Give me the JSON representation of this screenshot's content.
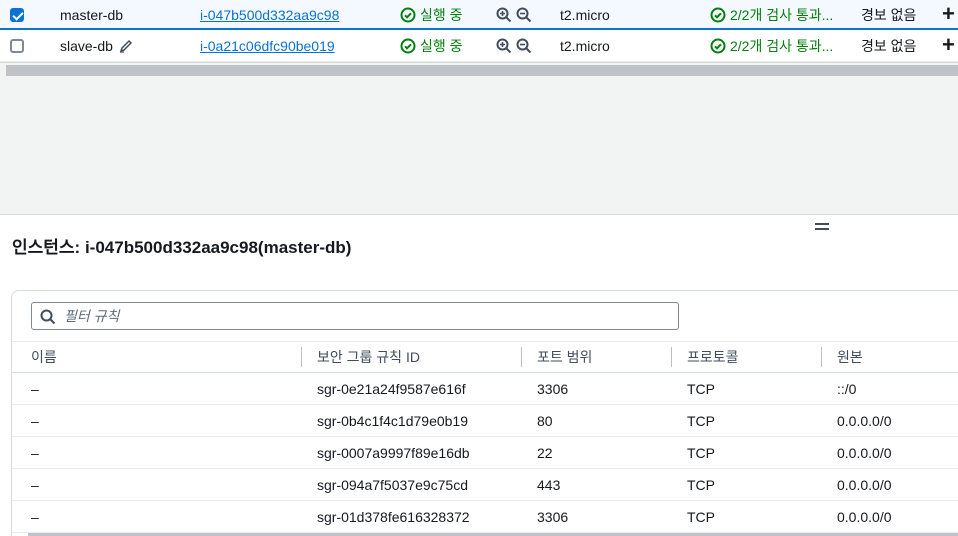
{
  "instances": [
    {
      "checked": true,
      "name": "master-db",
      "instance_id": "i-047b500d332aa9c98",
      "state": "실행 중",
      "type": "t2.micro",
      "status_check": "2/2개 검사 통과...",
      "alarm": "경보 없음",
      "add": "+"
    },
    {
      "checked": false,
      "name": "slave-db",
      "instance_id": "i-0a21c06dfc90be019",
      "state": "실행 중",
      "type": "t2.micro",
      "status_check": "2/2개 검사 통과...",
      "alarm": "경보 없음",
      "add": "+"
    }
  ],
  "panel": {
    "title": "인스턴스: i-047b500d332aa9c98(master-db)"
  },
  "rules": {
    "filter_placeholder": "필터 규칙",
    "columns": [
      "이름",
      "보안 그룹 규칙 ID",
      "포트 범위",
      "프로토콜",
      "원본"
    ],
    "rows": [
      [
        "–",
        "sgr-0e21a24f9587e616f",
        "3306",
        "TCP",
        "::/0"
      ],
      [
        "–",
        "sgr-0b4c1f4c1d79e0b19",
        "80",
        "TCP",
        "0.0.0.0/0"
      ],
      [
        "–",
        "sgr-0007a9997f89e16db",
        "22",
        "TCP",
        "0.0.0.0/0"
      ],
      [
        "–",
        "sgr-094a7f5037e9c75cd",
        "443",
        "TCP",
        "0.0.0.0/0"
      ],
      [
        "–",
        "sgr-01d378fe616328372",
        "3306",
        "TCP",
        "0.0.0.0/0"
      ]
    ]
  },
  "icons": {
    "ok": "status-ok-icon",
    "zoom_in": "zoom-in-icon",
    "zoom_out": "zoom-out-icon",
    "edit": "edit-pencil-icon",
    "search": "search-icon",
    "resize": "drag-handle-icon"
  },
  "colors": {
    "link": "#0972d3",
    "success": "#037f0c",
    "selected_row_border": "#0972d3"
  }
}
